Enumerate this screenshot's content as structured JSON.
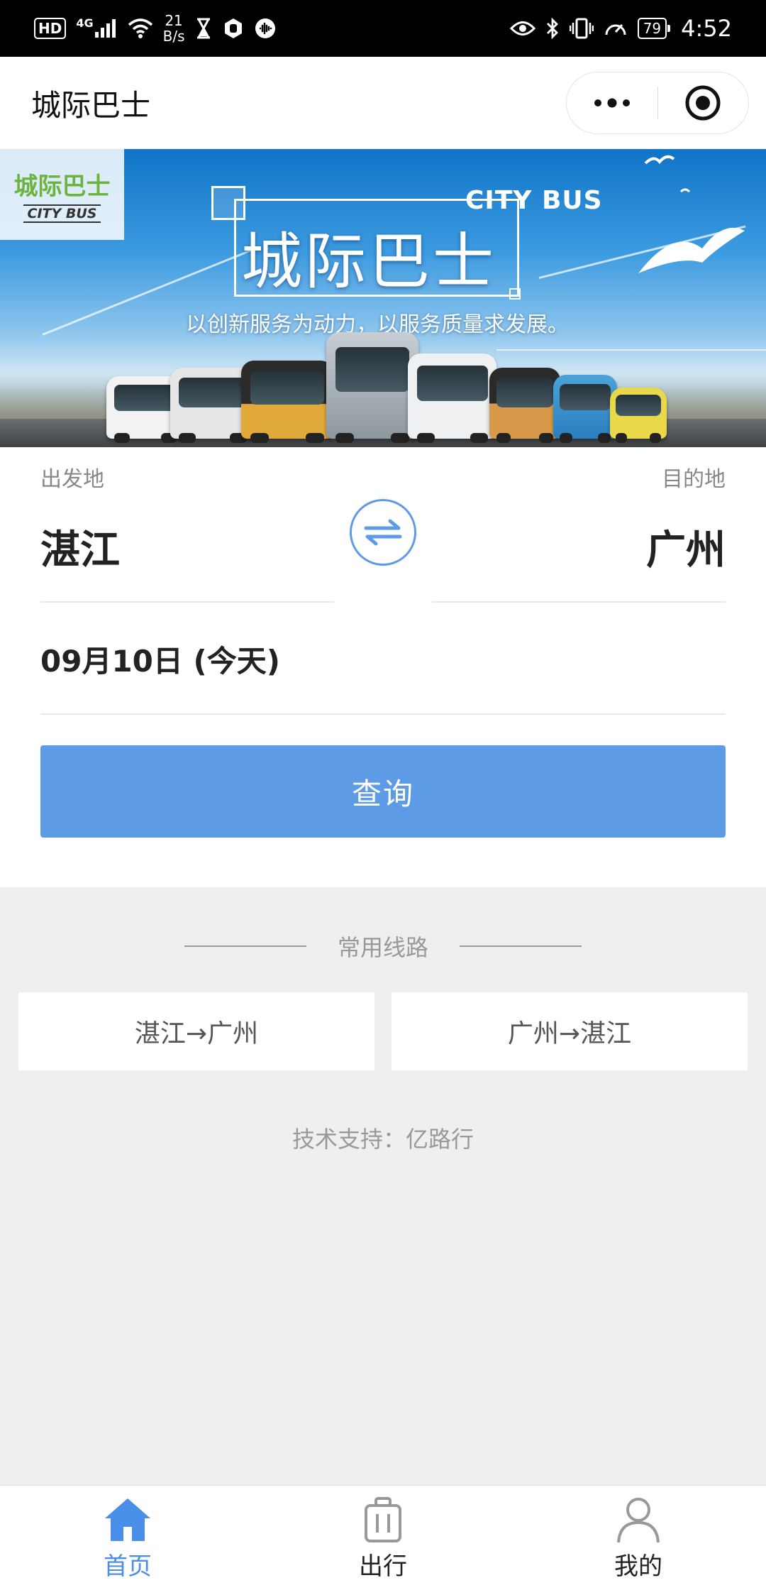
{
  "status_bar": {
    "hd": "HD",
    "net": "4G",
    "speed_value": "21",
    "speed_unit": "B/s",
    "battery": "79",
    "time": "4:52"
  },
  "title_bar": {
    "title": "城际巴士"
  },
  "banner": {
    "logo_cn": "城际巴士",
    "logo_en": "CITY BUS",
    "brand_en": "CITY BUS",
    "title": "城际巴士",
    "slogan": "以创新服务为动力，以服务质量求发展。"
  },
  "form": {
    "departure_label": "出发地",
    "departure_city": "湛江",
    "destination_label": "目的地",
    "destination_city": "广州",
    "date": "09月10日 (今天)",
    "search_label": "查询"
  },
  "routes": {
    "title": "常用线路",
    "items": [
      "湛江→广州",
      "广州→湛江"
    ]
  },
  "support": "技术支持：亿路行",
  "tabs": [
    {
      "label": "首页",
      "icon": "home-icon",
      "active": true
    },
    {
      "label": "出行",
      "icon": "luggage-icon",
      "active": false
    },
    {
      "label": "我的",
      "icon": "person-icon",
      "active": false
    }
  ],
  "colors": {
    "accent": "#5e9be6",
    "tab_active": "#4a8fe7",
    "background": "#efefef"
  }
}
